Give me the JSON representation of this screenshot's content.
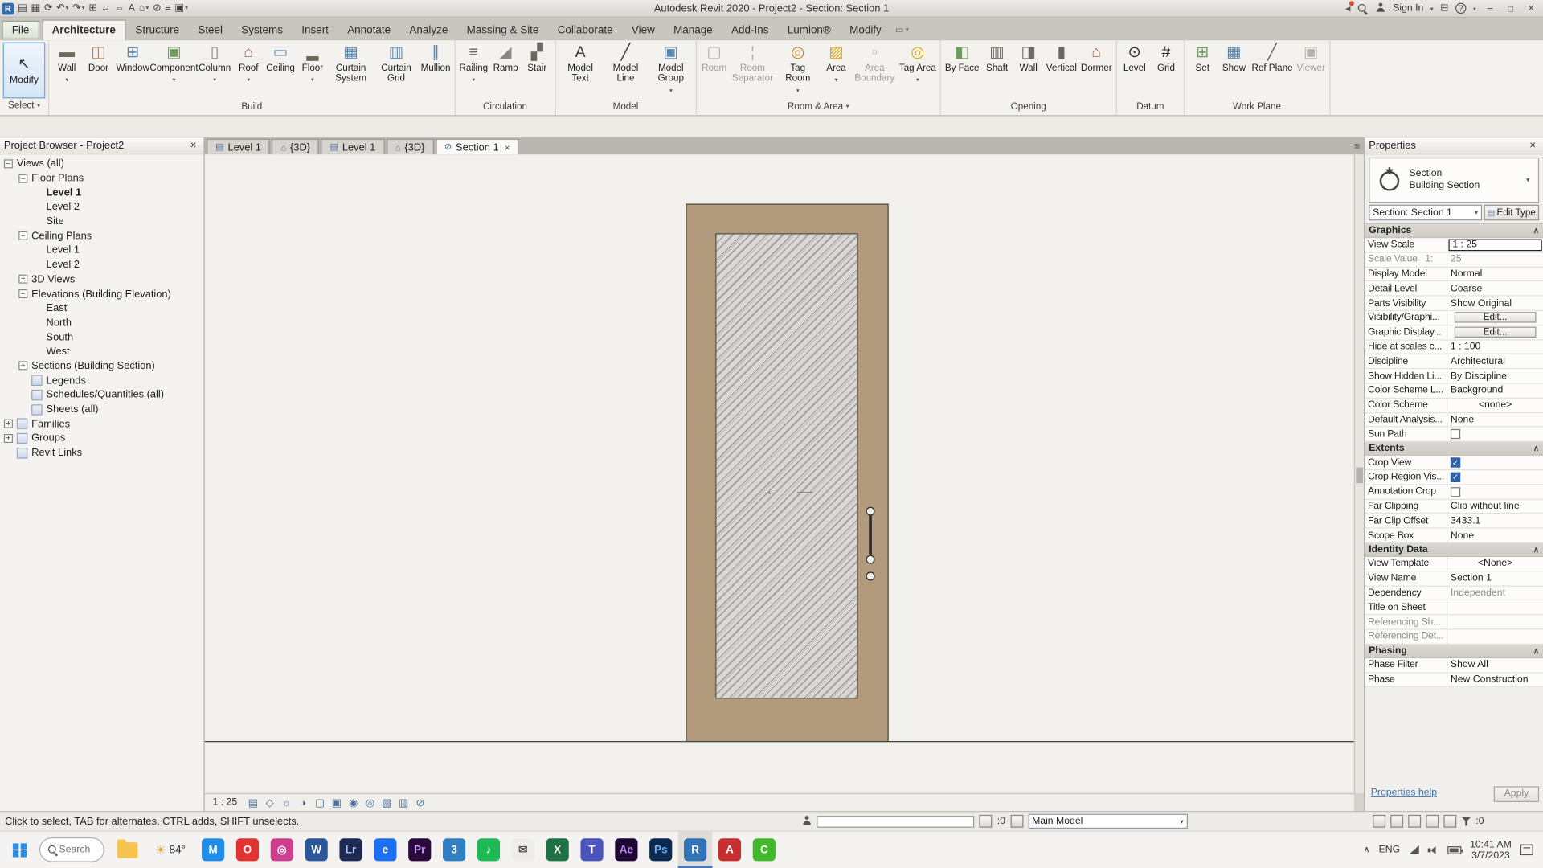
{
  "titlebar": {
    "title": "Autodesk Revit 2020 - Project2 - Section: Section 1",
    "sign_in": "Sign In",
    "help_glyph": "?",
    "qat": [
      {
        "name": "app-logo",
        "glyph": "R",
        "applogo": true
      },
      {
        "name": "open",
        "glyph": "▤"
      },
      {
        "name": "save",
        "glyph": "▦"
      },
      {
        "name": "sync",
        "glyph": "⟳"
      },
      {
        "name": "undo",
        "glyph": "↶",
        "caret": true
      },
      {
        "name": "redo",
        "glyph": "↷",
        "caret": true
      },
      {
        "name": "print",
        "glyph": "⊞"
      },
      {
        "name": "measure",
        "glyph": "↔"
      },
      {
        "name": "aligned-dimension",
        "glyph": "⇔"
      },
      {
        "name": "text",
        "glyph": "A"
      },
      {
        "name": "default-3d-view",
        "glyph": "⌂",
        "caret": true
      },
      {
        "name": "section",
        "glyph": "⊘"
      },
      {
        "name": "thin-lines",
        "glyph": "≡"
      },
      {
        "name": "switch-windows",
        "glyph": "▣",
        "caret": true
      }
    ]
  },
  "ribbon": {
    "tabs": [
      {
        "label": "File",
        "file": true
      },
      {
        "label": "Architecture",
        "active": true
      },
      {
        "label": "Structure"
      },
      {
        "label": "Steel"
      },
      {
        "label": "Systems"
      },
      {
        "label": "Insert"
      },
      {
        "label": "Annotate"
      },
      {
        "label": "Analyze"
      },
      {
        "label": "Massing & Site"
      },
      {
        "label": "Collaborate"
      },
      {
        "label": "View"
      },
      {
        "label": "Manage"
      },
      {
        "label": "Add-Ins"
      },
      {
        "label": "Lumion®"
      },
      {
        "label": "Modify"
      }
    ],
    "select_panel": {
      "name": "Select",
      "modify_label": "Modify",
      "modify_glyph": "↖"
    },
    "panels": [
      {
        "name": "Build",
        "tools": [
          {
            "label": "Wall",
            "glyph": "▬",
            "c": "#6e6a60",
            "caret": true
          },
          {
            "label": "Door",
            "glyph": "◫",
            "c": "#a8825a"
          },
          {
            "label": "Window",
            "glyph": "⊞",
            "c": "#5b87b0"
          },
          {
            "label": "Component",
            "glyph": "▣",
            "c": "#6f9b5e",
            "caret": true
          },
          {
            "label": "Column",
            "glyph": "▯",
            "c": "#8a877f",
            "caret": true
          },
          {
            "label": "Roof",
            "glyph": "⌂",
            "c": "#a05f46",
            "caret": true
          },
          {
            "label": "Ceiling",
            "glyph": "▭",
            "c": "#5b87b0"
          },
          {
            "label": "Floor",
            "glyph": "▂",
            "c": "#6e6a60",
            "caret": true
          },
          {
            "label": "Curtain System",
            "glyph": "▦",
            "c": "#5b87b0"
          },
          {
            "label": "Curtain Grid",
            "glyph": "▥",
            "c": "#5b87b0"
          },
          {
            "label": "Mullion",
            "glyph": "∥",
            "c": "#5b87b0"
          }
        ]
      },
      {
        "name": "Circulation",
        "tools": [
          {
            "label": "Railing",
            "glyph": "≡",
            "c": "#6e6a60",
            "caret": true
          },
          {
            "label": "Ramp",
            "glyph": "◢",
            "c": "#8a877f"
          },
          {
            "label": "Stair",
            "glyph": "▞",
            "c": "#6e6a60"
          }
        ]
      },
      {
        "name": "Model",
        "tools": [
          {
            "label": "Model Text",
            "glyph": "A",
            "c": "#3c3c3c"
          },
          {
            "label": "Model Line",
            "glyph": "╱",
            "c": "#3c3c3c"
          },
          {
            "label": "Model Group",
            "glyph": "▣",
            "c": "#5b87b0",
            "caret": true
          }
        ]
      },
      {
        "name": "Room & Area",
        "caret": true,
        "tools": [
          {
            "label": "Room",
            "glyph": "▢",
            "c": "#a09d97",
            "disabled": true
          },
          {
            "label": "Room Separator",
            "glyph": "¦",
            "c": "#a09d97",
            "disabled": true
          },
          {
            "label": "Tag Room",
            "glyph": "◎",
            "c": "#b58a2a",
            "caret": true
          },
          {
            "label": "Area",
            "glyph": "▨",
            "c": "#d8a517",
            "caret": true
          },
          {
            "label": "Area Boundary",
            "glyph": "▫",
            "c": "#a09d97",
            "disabled": true
          },
          {
            "label": "Tag Area",
            "glyph": "◎",
            "c": "#d8a517",
            "caret": true
          }
        ]
      },
      {
        "name": "Opening",
        "tools": [
          {
            "label": "By Face",
            "glyph": "◧",
            "c": "#6f9b5e"
          },
          {
            "label": "Shaft",
            "glyph": "▥",
            "c": "#6e6a60"
          },
          {
            "label": "Wall",
            "glyph": "◨",
            "c": "#6e6a60"
          },
          {
            "label": "Vertical",
            "glyph": "▮",
            "c": "#6e6a60"
          },
          {
            "label": "Dormer",
            "glyph": "⌂",
            "c": "#a05f46"
          }
        ]
      },
      {
        "name": "Datum",
        "tools": [
          {
            "label": "Level",
            "glyph": "⊙",
            "c": "#2d2d2d"
          },
          {
            "label": "Grid",
            "glyph": "#",
            "c": "#2d2d2d"
          }
        ]
      },
      {
        "name": "Work Plane",
        "tools": [
          {
            "label": "Set",
            "glyph": "⊞",
            "c": "#6f9b5e"
          },
          {
            "label": "Show",
            "glyph": "▦",
            "c": "#5b87b0"
          },
          {
            "label": "Ref Plane",
            "glyph": "╱",
            "c": "#6e6a60"
          },
          {
            "label": "Viewer",
            "glyph": "▣",
            "c": "#a09d97",
            "disabled": true
          }
        ]
      }
    ]
  },
  "project_browser": {
    "title": "Project Browser - Project2",
    "items": [
      {
        "label": "Views (all)",
        "depth": 0,
        "exp": "−"
      },
      {
        "label": "Floor Plans",
        "depth": 1,
        "exp": "−"
      },
      {
        "label": "Level 1",
        "depth": 2,
        "noexp": true,
        "bold": true
      },
      {
        "label": "Level 2",
        "depth": 2,
        "noexp": true
      },
      {
        "label": "Site",
        "depth": 2,
        "noexp": true
      },
      {
        "label": "Ceiling Plans",
        "depth": 1,
        "exp": "−"
      },
      {
        "label": "Level 1",
        "depth": 2,
        "noexp": true
      },
      {
        "label": "Level 2",
        "depth": 2,
        "noexp": true
      },
      {
        "label": "3D Views",
        "depth": 1,
        "exp": "+"
      },
      {
        "label": "Elevations (Building Elevation)",
        "depth": 1,
        "exp": "−"
      },
      {
        "label": "East",
        "depth": 2,
        "noexp": true
      },
      {
        "label": "North",
        "depth": 2,
        "noexp": true
      },
      {
        "label": "South",
        "depth": 2,
        "noexp": true
      },
      {
        "label": "West",
        "depth": 2,
        "noexp": true
      },
      {
        "label": "Sections (Building Section)",
        "depth": 1,
        "exp": "+"
      },
      {
        "label": "Legends",
        "depth": 1,
        "noexp": true,
        "icon": true
      },
      {
        "label": "Schedules/Quantities (all)",
        "depth": 1,
        "noexp": true,
        "icon": true
      },
      {
        "label": "Sheets (all)",
        "depth": 1,
        "noexp": true,
        "icon": true
      },
      {
        "label": "Families",
        "depth": 0,
        "exp": "+",
        "icon": true
      },
      {
        "label": "Groups",
        "depth": 0,
        "exp": "+",
        "icon": true
      },
      {
        "label": "Revit Links",
        "depth": 0,
        "noexp": true,
        "icon": true
      }
    ]
  },
  "view_tabs": [
    {
      "icon": "▤",
      "label": "Level 1"
    },
    {
      "icon": "⌂",
      "label": "{3D}"
    },
    {
      "icon": "▤",
      "label": "Level 1"
    },
    {
      "icon": "⌂",
      "label": "{3D}"
    },
    {
      "icon": "⊘",
      "label": "Section 1",
      "active": true,
      "closable": true
    }
  ],
  "canvas": {
    "door_frame_color": "#b29b7d",
    "glass_color": "#d9d8d5"
  },
  "view_control_bar": {
    "scale": "1 : 25",
    "icons": [
      {
        "name": "detail-level",
        "glyph": "▤"
      },
      {
        "name": "visual-style",
        "glyph": "◇"
      },
      {
        "name": "sun-path",
        "glyph": "☼"
      },
      {
        "name": "shadows",
        "glyph": "◑"
      },
      {
        "name": "crop-view",
        "glyph": "▢"
      },
      {
        "name": "show-crop-region",
        "glyph": "▣"
      },
      {
        "name": "temporary-hide-isolate",
        "glyph": "◉"
      },
      {
        "name": "reveal-hidden-elements",
        "glyph": "◎"
      },
      {
        "name": "temporary-view-properties",
        "glyph": "▧"
      },
      {
        "name": "hide-analytical-model",
        "glyph": "▥"
      },
      {
        "name": "reveal-constraints",
        "glyph": "⊘"
      }
    ]
  },
  "properties": {
    "title": "Properties",
    "type_preview": {
      "family": "Section",
      "type": "Building Section"
    },
    "type_selector": "Section: Section 1",
    "edit_type": "Edit Type",
    "collapse_glyph": "∧",
    "help": "Properties help",
    "apply": "Apply",
    "groups": [
      {
        "title": "Graphics",
        "rows": [
          {
            "label": "View Scale",
            "value": "1 : 25",
            "selected": true
          },
          {
            "label": "Scale Value   1:",
            "value": "25",
            "mlab": true,
            "mval": true
          },
          {
            "label": "Display Model",
            "value": "Normal"
          },
          {
            "label": "Detail Level",
            "value": "Coarse"
          },
          {
            "label": "Parts Visibility",
            "value": "Show Original"
          },
          {
            "label": "Visibility/Graphi...",
            "value": "Edit...",
            "button": true
          },
          {
            "label": "Graphic Display...",
            "value": "Edit...",
            "button": true
          },
          {
            "label": "Hide at scales c...",
            "value": "1 : 100"
          },
          {
            "label": "Discipline",
            "value": "Architectural"
          },
          {
            "label": "Show Hidden Li...",
            "value": "By Discipline"
          },
          {
            "label": "Color Scheme L...",
            "value": "Background"
          },
          {
            "label": "Color Scheme",
            "value": "<none>",
            "centered": true
          },
          {
            "label": "Default Analysis...",
            "value": "None"
          },
          {
            "label": "Sun Path",
            "checkbox": true
          }
        ]
      },
      {
        "title": "Extents",
        "rows": [
          {
            "label": "Crop View",
            "checkbox": true,
            "checked": true
          },
          {
            "label": "Crop Region Vis...",
            "checkbox": true,
            "checked": true
          },
          {
            "label": "Annotation Crop",
            "checkbox": true
          },
          {
            "label": "Far Clipping",
            "value": "Clip without line"
          },
          {
            "label": "Far Clip Offset",
            "value": "3433.1"
          },
          {
            "label": "Scope Box",
            "value": "None"
          }
        ]
      },
      {
        "title": "Identity Data",
        "rows": [
          {
            "label": "View Template",
            "value": "<None>",
            "centered": true
          },
          {
            "label": "View Name",
            "value": "Section 1"
          },
          {
            "label": "Dependency",
            "value": "Independent",
            "mval": true
          },
          {
            "label": "Title on Sheet",
            "value": ""
          },
          {
            "label": "Referencing Sh...",
            "value": "",
            "mlab": true
          },
          {
            "label": "Referencing Det...",
            "value": "",
            "mlab": true
          }
        ]
      },
      {
        "title": "Phasing",
        "rows": [
          {
            "label": "Phase Filter",
            "value": "Show All"
          },
          {
            "label": "Phase",
            "value": "New Construction"
          }
        ]
      }
    ]
  },
  "status_bar": {
    "hint": "Click to select, TAB for alternates, CTRL adds, SHIFT unselects.",
    "requests_count": ":0",
    "design_option": "Main Model",
    "filter_count": ":0"
  },
  "taskbar": {
    "search_placeholder": "Search",
    "weather": {
      "glyph": "☀",
      "temp": "84°"
    },
    "apps": [
      {
        "name": "messenger",
        "letter": "M",
        "bg": "#1f8ce8"
      },
      {
        "name": "opera",
        "letter": "O",
        "bg": "#e23232"
      },
      {
        "name": "instagram",
        "letter": "◎",
        "bg": "#cf3d8e"
      },
      {
        "name": "word",
        "letter": "W",
        "bg": "#2b579a"
      },
      {
        "name": "lightroom",
        "letter": "Lr",
        "bg": "#1e2a52",
        "fg": "#9fc3ff"
      },
      {
        "name": "edge",
        "letter": "e",
        "bg": "#1b6ff0"
      },
      {
        "name": "premiere",
        "letter": "Pr",
        "bg": "#2a0a3a",
        "fg": "#c49af5"
      },
      {
        "name": "3ds-max",
        "letter": "3",
        "bg": "#2f7fc2"
      },
      {
        "name": "spotify",
        "letter": "♪",
        "bg": "#1db954"
      },
      {
        "name": "mail",
        "letter": "✉",
        "bg": "#efedea",
        "fg": "#555555"
      },
      {
        "name": "excel",
        "letter": "X",
        "bg": "#1e7145"
      },
      {
        "name": "teams",
        "letter": "T",
        "bg": "#4b53bc"
      },
      {
        "name": "after-effects",
        "letter": "Ae",
        "bg": "#1f0733",
        "fg": "#b78af0"
      },
      {
        "name": "photoshop",
        "letter": "Ps",
        "bg": "#0b2a52",
        "fg": "#6fb3f0"
      },
      {
        "name": "revit",
        "letter": "R",
        "bg": "#3273b5",
        "active": true
      },
      {
        "name": "acrobat",
        "letter": "A",
        "bg": "#c62f2f"
      },
      {
        "name": "wechat",
        "letter": "C",
        "bg": "#42b72a"
      }
    ],
    "tray": {
      "chevron": "∧",
      "lang": "ENG",
      "time": "10:41 AM",
      "date": "3/7/2023"
    }
  }
}
